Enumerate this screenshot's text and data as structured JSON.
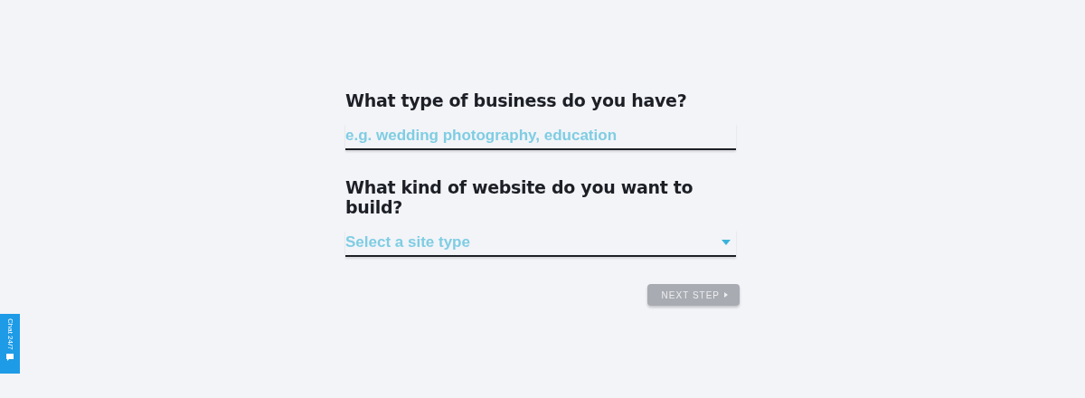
{
  "questions": [
    {
      "label": "What type of business do you have?",
      "kind": "text",
      "placeholder": "e.g. wedding photography, education"
    },
    {
      "label": "What kind of website do you want to build?",
      "kind": "select",
      "placeholder": "Select a site type"
    }
  ],
  "next_button": {
    "label": "NEXT STEP",
    "disabled": true
  },
  "chat_tab": {
    "label": "Chat 24/7"
  }
}
